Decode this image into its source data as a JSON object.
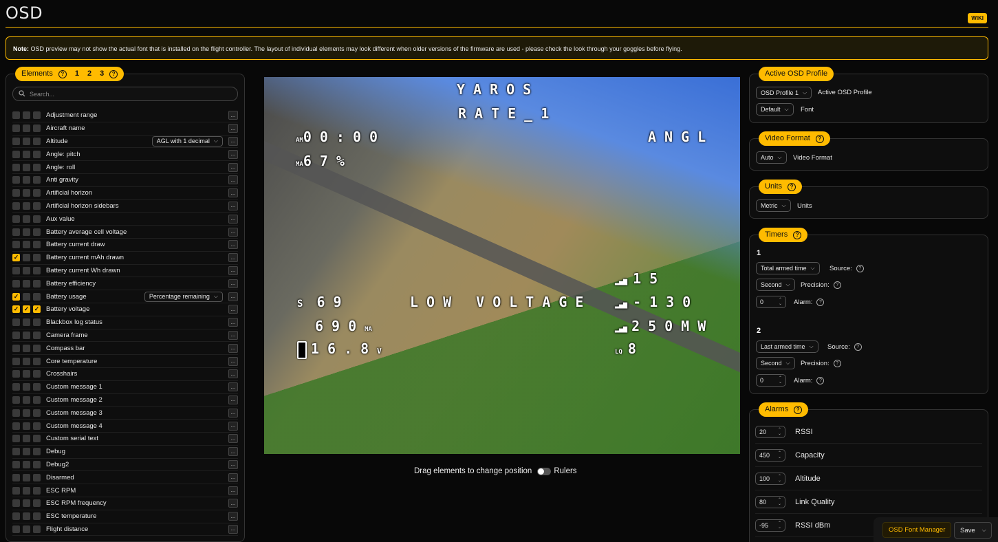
{
  "page": {
    "title": "OSD",
    "wiki_label": "WIKI"
  },
  "note": {
    "prefix": "Note:",
    "text": " OSD preview may not show the actual font that is installed on the flight controller. The layout of individual elements may look different when older versions of the firmware are used - please check the look through your goggles before flying."
  },
  "elements_panel": {
    "title": "Elements",
    "profile_tabs": [
      "1",
      "2",
      "3"
    ],
    "search_placeholder": "Search...",
    "items": [
      {
        "label": "Adjustment range",
        "checks": [
          false,
          false,
          false
        ]
      },
      {
        "label": "Aircraft name",
        "checks": [
          false,
          false,
          false
        ]
      },
      {
        "label": "Altitude",
        "checks": [
          false,
          false,
          false
        ],
        "option": "AGL with 1 decimal"
      },
      {
        "label": "Angle: pitch",
        "checks": [
          false,
          false,
          false
        ]
      },
      {
        "label": "Angle: roll",
        "checks": [
          false,
          false,
          false
        ]
      },
      {
        "label": "Anti gravity",
        "checks": [
          false,
          false,
          false
        ]
      },
      {
        "label": "Artificial horizon",
        "checks": [
          false,
          false,
          false
        ]
      },
      {
        "label": "Artificial horizon sidebars",
        "checks": [
          false,
          false,
          false
        ]
      },
      {
        "label": "Aux value",
        "checks": [
          false,
          false,
          false
        ]
      },
      {
        "label": "Battery average cell voltage",
        "checks": [
          false,
          false,
          false
        ]
      },
      {
        "label": "Battery current draw",
        "checks": [
          false,
          false,
          false
        ]
      },
      {
        "label": "Battery current mAh drawn",
        "checks": [
          true,
          false,
          false
        ]
      },
      {
        "label": "Battery current Wh drawn",
        "checks": [
          false,
          false,
          false
        ]
      },
      {
        "label": "Battery efficiency",
        "checks": [
          false,
          false,
          false
        ]
      },
      {
        "label": "Battery usage",
        "checks": [
          true,
          false,
          false
        ],
        "option": "Percentage remaining"
      },
      {
        "label": "Battery voltage",
        "checks": [
          true,
          true,
          true
        ]
      },
      {
        "label": "Blackbox log status",
        "checks": [
          false,
          false,
          false
        ]
      },
      {
        "label": "Camera frame",
        "checks": [
          false,
          false,
          false
        ]
      },
      {
        "label": "Compass bar",
        "checks": [
          false,
          false,
          false
        ]
      },
      {
        "label": "Core temperature",
        "checks": [
          false,
          false,
          false
        ]
      },
      {
        "label": "Crosshairs",
        "checks": [
          false,
          false,
          false
        ]
      },
      {
        "label": "Custom message 1",
        "checks": [
          false,
          false,
          false
        ]
      },
      {
        "label": "Custom message 2",
        "checks": [
          false,
          false,
          false
        ]
      },
      {
        "label": "Custom message 3",
        "checks": [
          false,
          false,
          false
        ]
      },
      {
        "label": "Custom message 4",
        "checks": [
          false,
          false,
          false
        ]
      },
      {
        "label": "Custom serial text",
        "checks": [
          false,
          false,
          false
        ]
      },
      {
        "label": "Debug",
        "checks": [
          false,
          false,
          false
        ]
      },
      {
        "label": "Debug2",
        "checks": [
          false,
          false,
          false
        ]
      },
      {
        "label": "Disarmed",
        "checks": [
          false,
          false,
          false
        ]
      },
      {
        "label": "ESC RPM",
        "checks": [
          false,
          false,
          false
        ]
      },
      {
        "label": "ESC RPM frequency",
        "checks": [
          false,
          false,
          false
        ]
      },
      {
        "label": "ESC temperature",
        "checks": [
          false,
          false,
          false
        ]
      },
      {
        "label": "Flight distance",
        "checks": [
          false,
          false,
          false
        ]
      }
    ],
    "dots_label": "..."
  },
  "preview": {
    "osd": {
      "craft": "YAROS",
      "rate": "RATE_1",
      "timer": "00:00",
      "timer_icon": "AM",
      "mode": "ANGL",
      "mah_pct": "67%",
      "mah_icon": "MA",
      "throttle": "69",
      "warning": "LOW VOLTAGE",
      "mah": "690",
      "mah_unit": "MA",
      "voltage": "16.8",
      "voltage_unit": "V",
      "rssi1": "15",
      "rssi2": "-130",
      "power": "250MW",
      "lq": "8",
      "lq_icon": "LQ"
    },
    "drag_label": "Drag elements to change position",
    "rulers_label": "Rulers"
  },
  "active_profile": {
    "title": "Active OSD Profile",
    "profile_value": "OSD Profile 1",
    "profile_label": "Active OSD Profile",
    "font_value": "Default",
    "font_label": "Font"
  },
  "video_format": {
    "title": "Video Format",
    "value": "Auto",
    "label": "Video Format"
  },
  "units": {
    "title": "Units",
    "value": "Metric",
    "label": "Units"
  },
  "timers": {
    "title": "Timers",
    "timer1": {
      "number": "1",
      "source": "Total armed time",
      "source_label": "Source:",
      "precision": "Second",
      "precision_label": "Precision:",
      "alarm": "0",
      "alarm_label": "Alarm:"
    },
    "timer2": {
      "number": "2",
      "source": "Last armed time",
      "source_label": "Source:",
      "precision": "Second",
      "precision_label": "Precision:",
      "alarm": "0",
      "alarm_label": "Alarm:"
    }
  },
  "alarms": {
    "title": "Alarms",
    "items": [
      {
        "value": "20",
        "label": "RSSI"
      },
      {
        "value": "450",
        "label": "Capacity"
      },
      {
        "value": "100",
        "label": "Altitude"
      },
      {
        "value": "80",
        "label": "Link Quality"
      },
      {
        "value": "-95",
        "label": "RSSI dBm"
      }
    ]
  },
  "footer": {
    "font_manager": "OSD Font Manager",
    "save": "Save"
  },
  "colors": {
    "accent": "#ffbb00",
    "background": "#080808"
  }
}
